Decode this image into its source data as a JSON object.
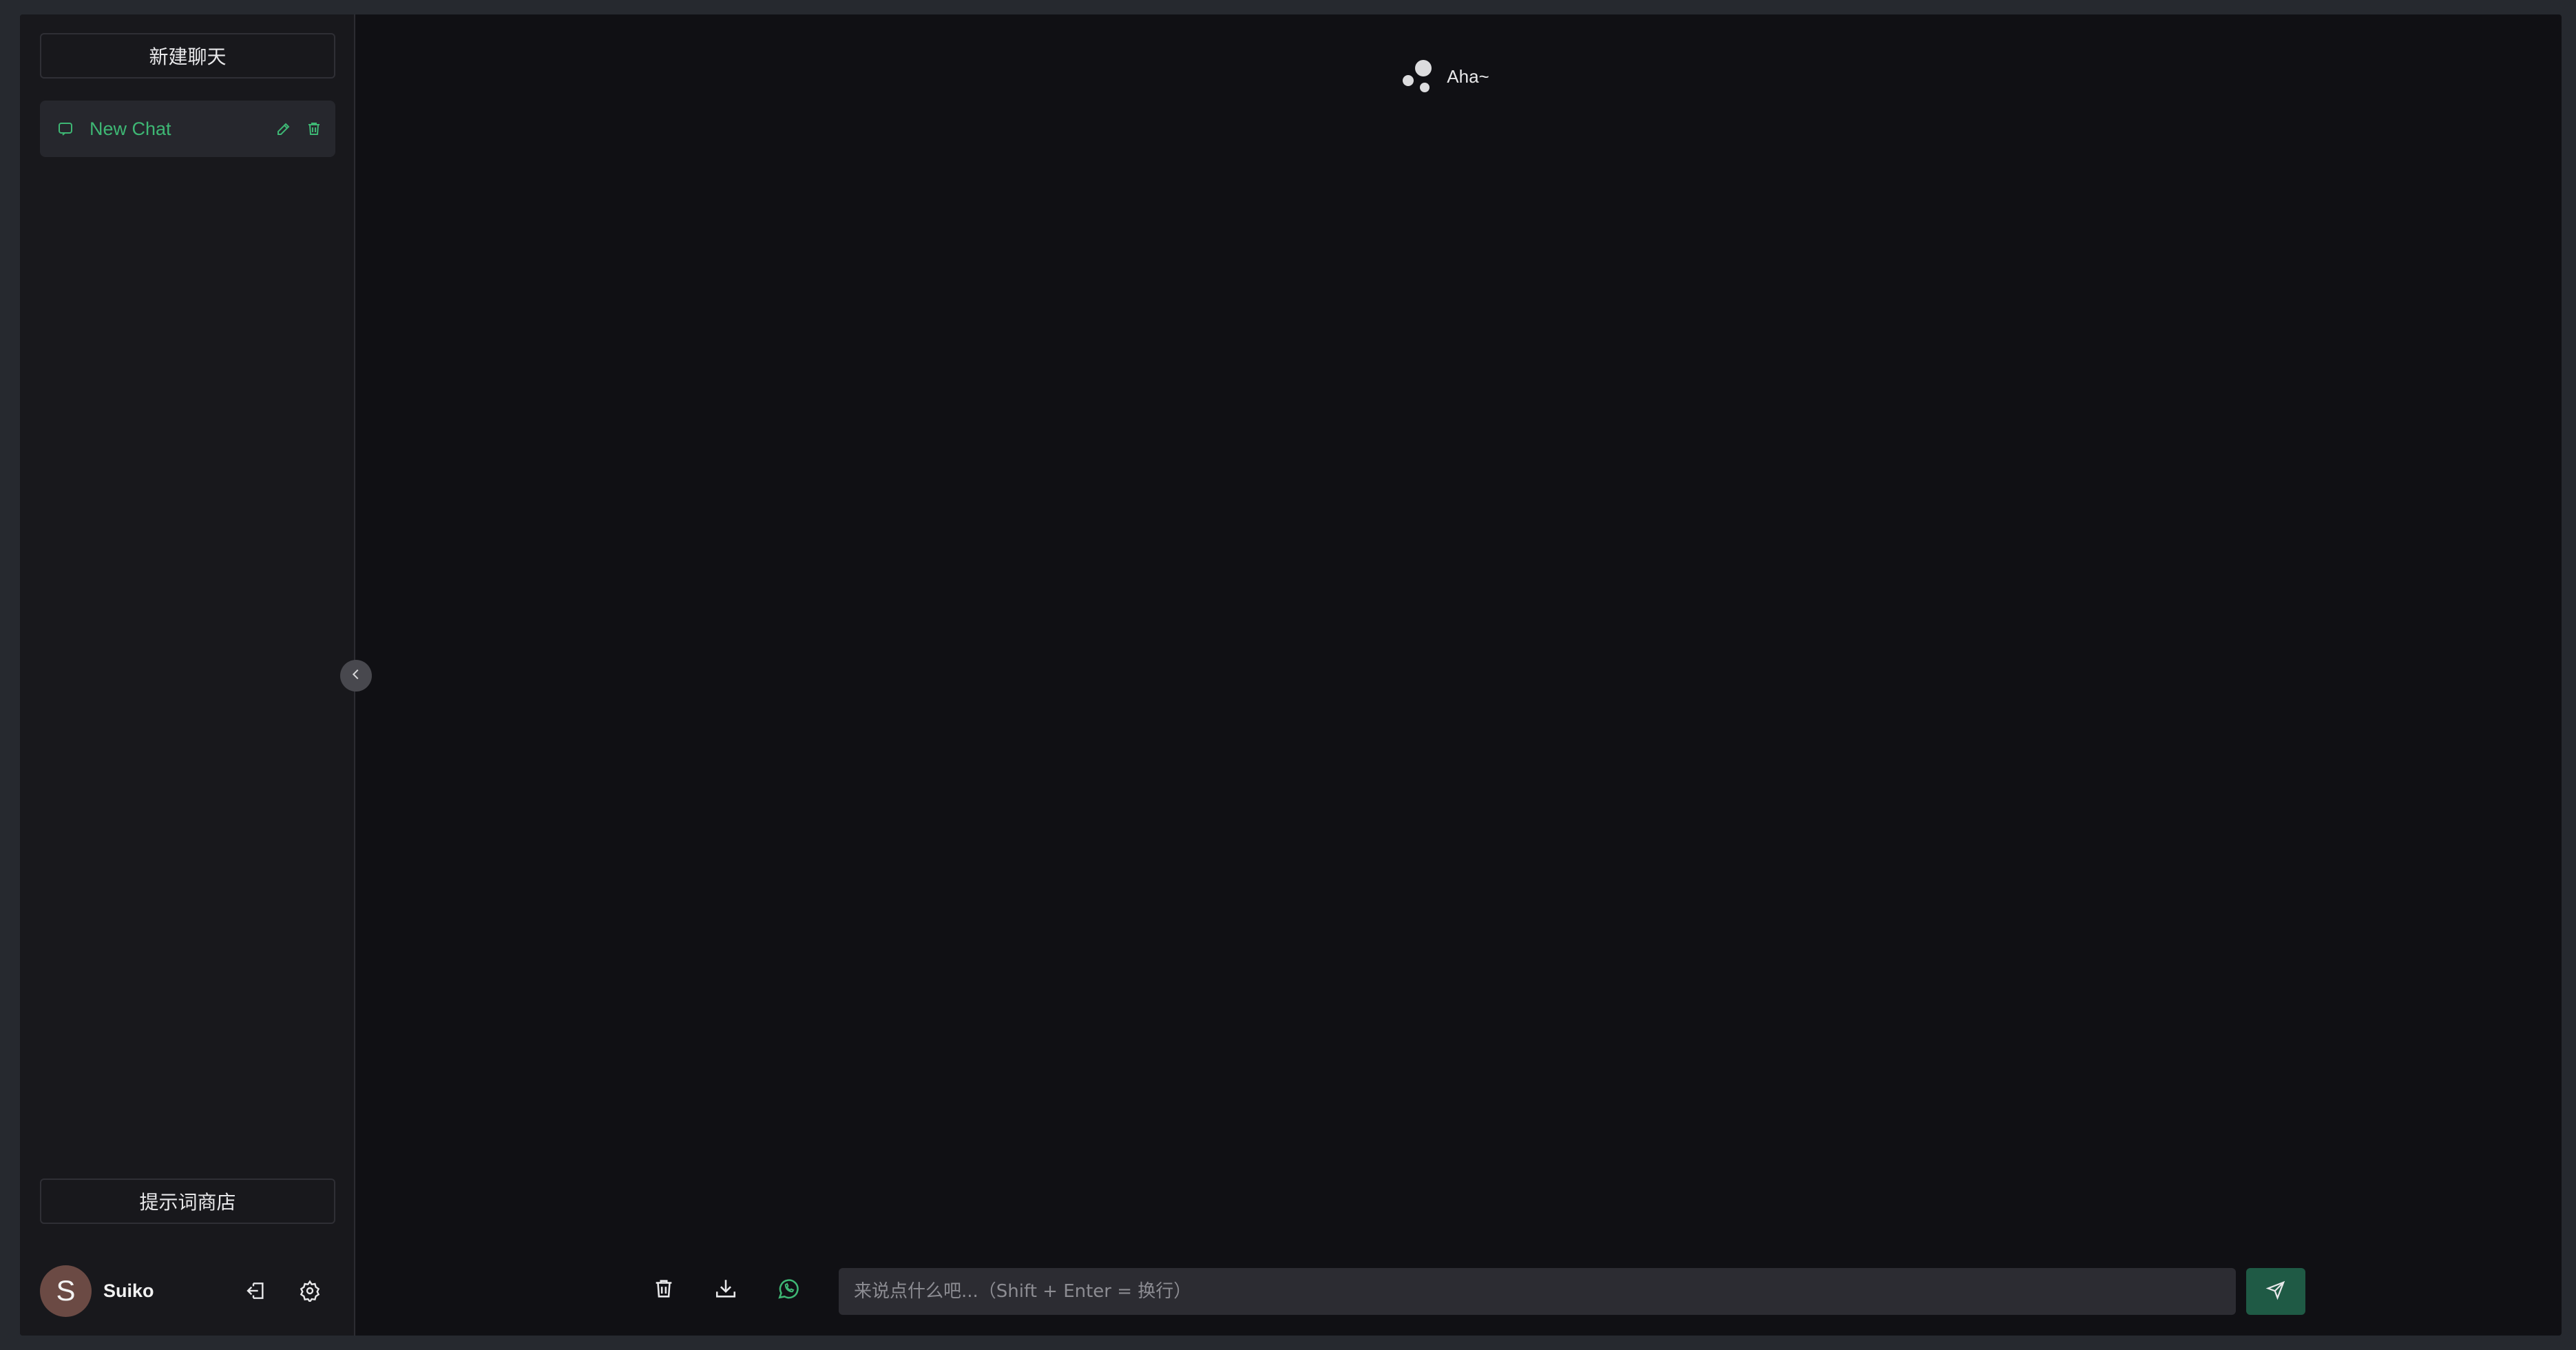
{
  "sidebar": {
    "new_chat_label": "新建聊天",
    "history": [
      {
        "label": "New Chat"
      }
    ],
    "prompt_store_label": "提示词商店",
    "user": {
      "avatar_initial": "S",
      "name": "Suiko"
    }
  },
  "header": {
    "title": "Aha~"
  },
  "footer": {
    "input_placeholder": "来说点什么吧...（Shift + Enter = 换行）",
    "input_value": ""
  },
  "colors": {
    "accent": "#3eb774",
    "send_button": "#1f5a45",
    "background": "#101014",
    "sidebar": "#18181c"
  },
  "icons": {
    "chat": "chat-icon",
    "edit": "edit-icon",
    "delete": "trash-icon",
    "logout": "logout-icon",
    "settings": "gear-icon",
    "collapse": "chevron-left-icon",
    "download": "download-icon",
    "chat_mode": "whatsapp-icon",
    "send": "send-icon",
    "logo": "bubbles-logo-icon"
  }
}
